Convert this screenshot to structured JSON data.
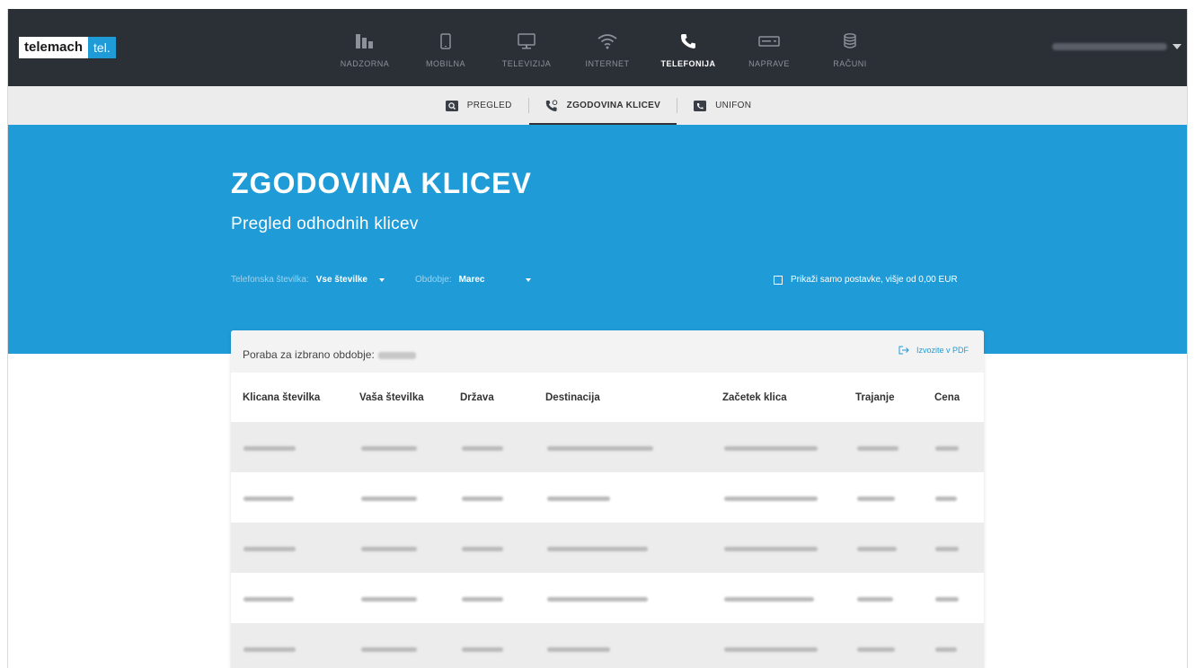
{
  "brand": {
    "wordmark": "telemach",
    "badge": "tel."
  },
  "nav": {
    "items": [
      {
        "label": "NADZORNA",
        "icon": "bar-chart-icon",
        "active": false
      },
      {
        "label": "MOBILNA",
        "icon": "mobile-phone-icon",
        "active": false
      },
      {
        "label": "TELEVIZIJA",
        "icon": "monitor-icon",
        "active": false
      },
      {
        "label": "INTERNET",
        "icon": "wifi-icon",
        "active": false
      },
      {
        "label": "TELEFONIJA",
        "icon": "phone-icon",
        "active": true
      },
      {
        "label": "NAPRAVE",
        "icon": "device-box-icon",
        "active": false
      },
      {
        "label": "RAČUNI",
        "icon": "coins-icon",
        "active": false
      }
    ]
  },
  "subnav": {
    "items": [
      {
        "label": "PREGLED",
        "icon": "search-icon",
        "active": false
      },
      {
        "label": "ZGODOVINA KLICEV",
        "icon": "call-history-icon",
        "active": true
      },
      {
        "label": "UNIFON",
        "icon": "unifon-icon",
        "active": false
      }
    ]
  },
  "hero": {
    "title": "ZGODOVINA KLICEV",
    "subtitle": "Pregled odhodnih klicev"
  },
  "filters": {
    "phone_label": "Telefonska številka:",
    "phone_value": "Vse številke",
    "period_label": "Obdobje:",
    "period_value": "Marec",
    "only_above_label": "Prikaži samo postavke, višje od 0,00 EUR"
  },
  "usage": {
    "label": "Poraba za izbrano obdobje:",
    "export_label": "Izvozite v PDF"
  },
  "table": {
    "columns": [
      "Klicana številka",
      "Vaša številka",
      "Država",
      "Destinacija",
      "Začetek klica",
      "Trajanje",
      "Cena"
    ]
  },
  "colors": {
    "topbar": "#2b2f36",
    "accent": "#1f9bd7",
    "subnav": "#ececec",
    "row_shade": "#ececec"
  }
}
